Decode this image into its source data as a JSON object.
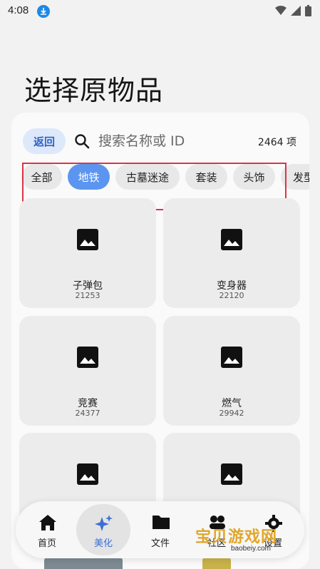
{
  "status": {
    "time": "4:08"
  },
  "title": "选择原物品",
  "toolbar": {
    "back_label": "返回",
    "search_placeholder": "搜索名称或 ID",
    "count": "2464 项"
  },
  "chips": [
    {
      "label": "全部",
      "active": false
    },
    {
      "label": "地铁",
      "active": true
    },
    {
      "label": "古墓迷途",
      "active": false
    },
    {
      "label": "套装",
      "active": false
    },
    {
      "label": "头饰",
      "active": false
    },
    {
      "label": "发型",
      "active": false
    }
  ],
  "items": [
    {
      "name": "子弹包",
      "id": "21253"
    },
    {
      "name": "变身器",
      "id": "22120"
    },
    {
      "name": "竞赛",
      "id": "24377"
    },
    {
      "name": "燃气",
      "id": "29942"
    },
    {
      "name": "",
      "id": ""
    },
    {
      "name": "",
      "id": ""
    }
  ],
  "nav": [
    {
      "label": "首页",
      "icon": "home-icon",
      "active": false
    },
    {
      "label": "美化",
      "icon": "sparkle-icon",
      "active": true
    },
    {
      "label": "文件",
      "icon": "folder-icon",
      "active": false
    },
    {
      "label": "社区",
      "icon": "community-icon",
      "active": false
    },
    {
      "label": "设置",
      "icon": "gear-icon",
      "active": false
    }
  ],
  "watermark": {
    "text": "宝贝游戏网",
    "url": "baobeiy.com"
  },
  "colors": {
    "accent": "#5b95f0",
    "back_bg": "#dde8fb",
    "highlight": "#d9344a"
  }
}
